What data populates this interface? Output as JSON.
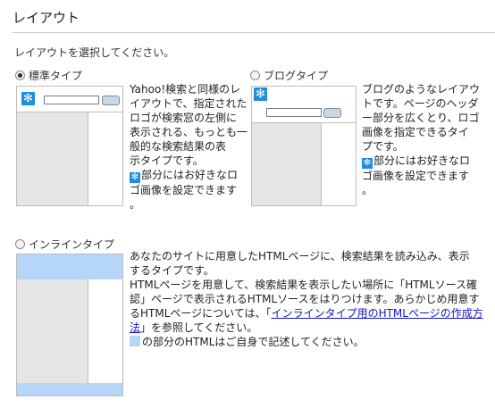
{
  "section": {
    "title": "レイアウト",
    "intro": "レイアウトを選択してください。"
  },
  "options": {
    "standard": {
      "label": "標準タイプ",
      "selected": true,
      "desc_lines": [
        "Yahoo!検索と同様のレ",
        "イアウトで、指定された",
        "ロゴが検索窓の左側に",
        "表示される、もっとも一",
        "般的な検索結果の表",
        "示タイプです。"
      ],
      "desc_note_lines": [
        "部分にはお好きなロ",
        "ゴ画像を設定できます",
        "。"
      ]
    },
    "blog": {
      "label": "ブログタイプ",
      "selected": false,
      "desc_lines": [
        "ブログのようなレイアウ",
        "トです。ページのヘッダ",
        "ー部分を広くとり、ロゴ",
        "画像を指定できるタイ",
        "プです。"
      ],
      "desc_note_lines": [
        "部分にはお好きなロ",
        "ゴ画像を設定できます",
        "。"
      ]
    },
    "inline": {
      "label": "インラインタイプ",
      "selected": false,
      "desc_line1": "あなたのサイトに用意したHTMLページに、検索結果を読み込み、表示",
      "desc_line2": "するタイプです。",
      "desc_line3": "HTMLページを用意して、検索結果を表示したい場所に「HTMLソース確",
      "desc_line4": "認」ページで表示されるHTMLソースをはりつけます。あらかじめ用意す",
      "desc_line5_pre": "るHTMLページについては、「",
      "desc_link_a": "インラインタイプ用のHTMLページの作成方",
      "desc_link_b": "法",
      "desc_line6_post": "」を参照してください。",
      "desc_note": "の部分のHTMLはご自身で記述してください。"
    }
  },
  "icons": {
    "star": "✻"
  },
  "colors": {
    "logo_blue": "#1e8fe0",
    "area_blue": "#b6d6f7",
    "link": "#1515c8"
  }
}
